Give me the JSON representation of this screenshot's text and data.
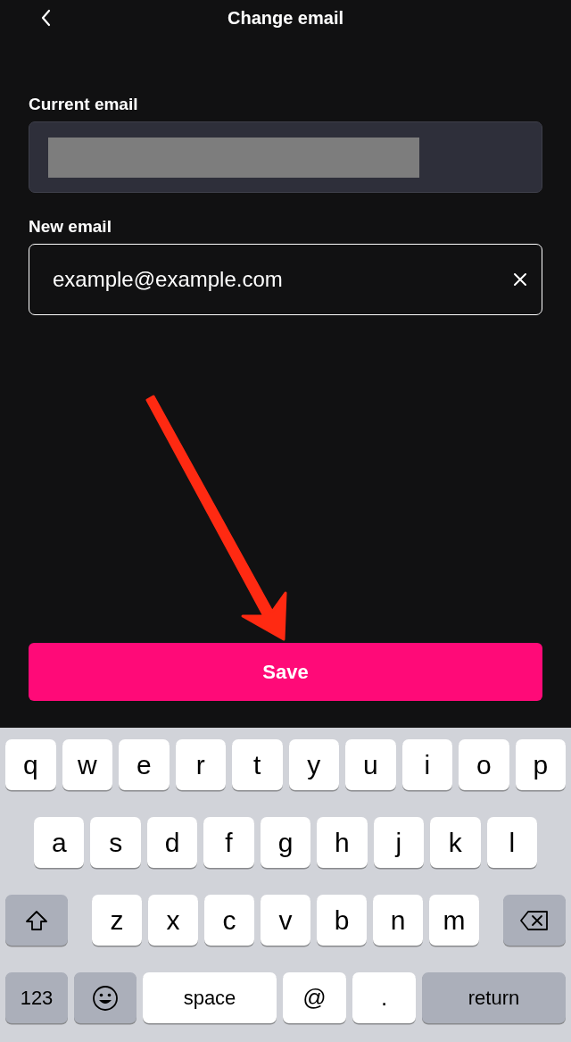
{
  "header": {
    "title": "Change email"
  },
  "current_email": {
    "label": "Current email",
    "redacted": true
  },
  "new_email": {
    "label": "New email",
    "value": "example@example.com"
  },
  "save_button": {
    "label": "Save"
  },
  "keyboard": {
    "rows": [
      {
        "keys": [
          {
            "label": "q",
            "kind": "letter"
          },
          {
            "label": "w",
            "kind": "letter"
          },
          {
            "label": "e",
            "kind": "letter"
          },
          {
            "label": "r",
            "kind": "letter"
          },
          {
            "label": "t",
            "kind": "letter"
          },
          {
            "label": "y",
            "kind": "letter"
          },
          {
            "label": "u",
            "kind": "letter"
          },
          {
            "label": "i",
            "kind": "letter"
          },
          {
            "label": "o",
            "kind": "letter"
          },
          {
            "label": "p",
            "kind": "letter"
          }
        ]
      },
      {
        "keys": [
          {
            "label": "a",
            "kind": "letter"
          },
          {
            "label": "s",
            "kind": "letter"
          },
          {
            "label": "d",
            "kind": "letter"
          },
          {
            "label": "f",
            "kind": "letter"
          },
          {
            "label": "g",
            "kind": "letter"
          },
          {
            "label": "h",
            "kind": "letter"
          },
          {
            "label": "j",
            "kind": "letter"
          },
          {
            "label": "k",
            "kind": "letter"
          },
          {
            "label": "l",
            "kind": "letter"
          }
        ]
      },
      {
        "keys": [
          {
            "kind": "shift"
          },
          {
            "label": "z",
            "kind": "letter"
          },
          {
            "label": "x",
            "kind": "letter"
          },
          {
            "label": "c",
            "kind": "letter"
          },
          {
            "label": "v",
            "kind": "letter"
          },
          {
            "label": "b",
            "kind": "letter"
          },
          {
            "label": "n",
            "kind": "letter"
          },
          {
            "label": "m",
            "kind": "letter"
          },
          {
            "kind": "delete"
          }
        ]
      },
      {
        "keys": [
          {
            "label": "123",
            "kind": "mode"
          },
          {
            "kind": "emoji"
          },
          {
            "label": "space",
            "kind": "space"
          },
          {
            "label": "@",
            "kind": "symbol"
          },
          {
            "label": ".",
            "kind": "symbol"
          },
          {
            "label": "return",
            "kind": "return"
          }
        ]
      }
    ]
  }
}
